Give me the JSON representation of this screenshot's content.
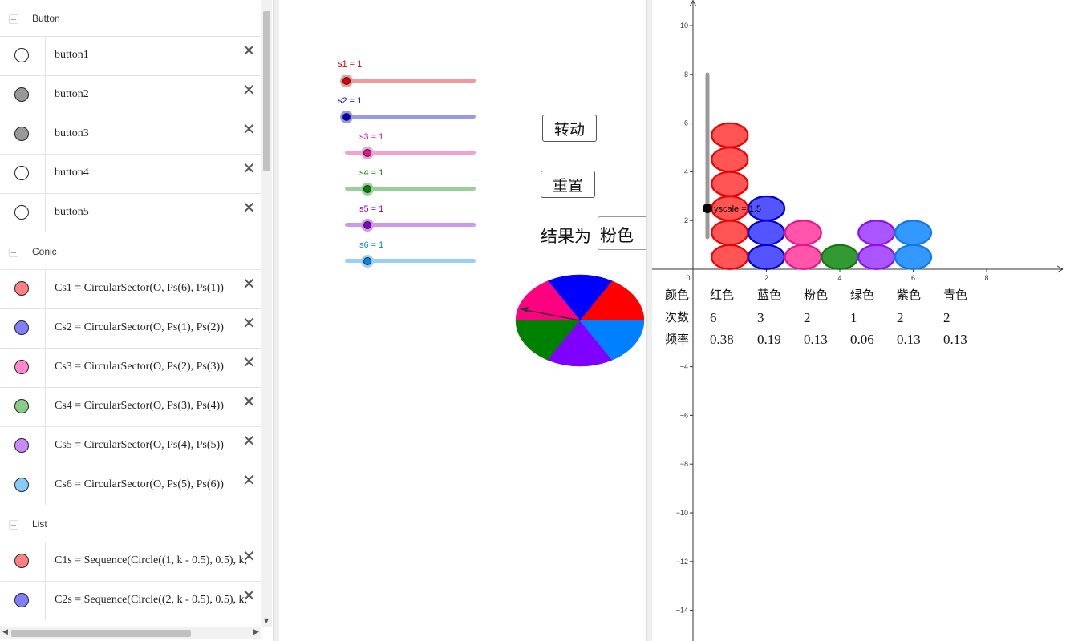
{
  "algebra": {
    "groups": [
      {
        "name": "Button",
        "items": [
          {
            "label": "button1",
            "color": "#ffffff"
          },
          {
            "label": "button2",
            "color": "#999999"
          },
          {
            "label": "button3",
            "color": "#999999"
          },
          {
            "label": "button4",
            "color": "#ffffff"
          },
          {
            "label": "button5",
            "color": "#ffffff"
          }
        ]
      },
      {
        "name": "Conic",
        "items": [
          {
            "label": "Cs1 = CircularSector(O, Ps(6), Ps(1))",
            "color": "#ff8080"
          },
          {
            "label": "Cs2 = CircularSector(O, Ps(1), Ps(2))",
            "color": "#8080ff"
          },
          {
            "label": "Cs3 = CircularSector(O, Ps(2), Ps(3))",
            "color": "#ff88c8"
          },
          {
            "label": "Cs4 = CircularSector(O, Ps(3), Ps(4))",
            "color": "#88cc88"
          },
          {
            "label": "Cs5 = CircularSector(O, Ps(4), Ps(5))",
            "color": "#cc88ff"
          },
          {
            "label": "Cs6 = CircularSector(O, Ps(5), Ps(6))",
            "color": "#88ccff"
          }
        ]
      },
      {
        "name": "List",
        "items": [
          {
            "label": "C1s = Sequence(Circle((1, k - 0.5), 0.5), k,",
            "color": "#ff8080"
          },
          {
            "label": "C2s = Sequence(Circle((2, k - 0.5), 0.5), k,",
            "color": "#8080ff"
          }
        ]
      }
    ],
    "delete_glyph": "✕"
  },
  "sliders": [
    {
      "label": "s1 = 1",
      "color": "#dd0000",
      "value": 1
    },
    {
      "label": "s2 = 1",
      "color": "#0000cc",
      "value": 1
    },
    {
      "label": "s3 = 1",
      "color": "#e0168b",
      "value": 1
    },
    {
      "label": "s4 = 1",
      "color": "#008800",
      "value": 1
    },
    {
      "label": "s5 = 1",
      "color": "#8800cc",
      "value": 1
    },
    {
      "label": "s6 = 1",
      "color": "#0088ee",
      "value": 1
    }
  ],
  "buttons": {
    "spin": "转动",
    "reset": "重置"
  },
  "result": {
    "label": "结果为",
    "value": "粉色"
  },
  "spinner": {
    "sectors": [
      {
        "name": "红色",
        "color": "#ff0000"
      },
      {
        "name": "蓝色",
        "color": "#0000ff"
      },
      {
        "name": "粉色",
        "color": "#ff0080"
      },
      {
        "name": "绿色",
        "color": "#008000"
      },
      {
        "name": "紫色",
        "color": "#8000ff"
      },
      {
        "name": "青色",
        "color": "#0080ff"
      }
    ]
  },
  "chart_data": {
    "type": "scatter",
    "x_ticks": [
      "0",
      "2",
      "4",
      "6",
      "8"
    ],
    "y_ticks": [
      "10",
      "8",
      "6",
      "4",
      "2",
      "−4",
      "−6",
      "−8",
      "−10",
      "−12",
      "−14"
    ],
    "xlim": [
      -1,
      10.2
    ],
    "ylim": [
      -15.3,
      11
    ],
    "yscale_label": "yscale = 1.5",
    "yscale_value": 1.5,
    "columns": [
      {
        "x": 1,
        "count": 6,
        "fill": "#ff5555",
        "stroke": "#ee0000"
      },
      {
        "x": 2,
        "count": 3,
        "fill": "#5555ff",
        "stroke": "#0000cc"
      },
      {
        "x": 3,
        "count": 2,
        "fill": "#ff55aa",
        "stroke": "#ee1188"
      },
      {
        "x": 4,
        "count": 1,
        "fill": "#339933",
        "stroke": "#117711"
      },
      {
        "x": 5,
        "count": 2,
        "fill": "#aa55ff",
        "stroke": "#8811ee"
      },
      {
        "x": 6,
        "count": 2,
        "fill": "#3399ff",
        "stroke": "#1177ee"
      }
    ],
    "table": {
      "header": [
        "颜色",
        "红色",
        "蓝色",
        "粉色",
        "绿色",
        "紫色",
        "青色"
      ],
      "count_label": "次数",
      "counts": [
        "6",
        "3",
        "2",
        "1",
        "2",
        "2"
      ],
      "freq_label": "频率",
      "freqs": [
        "0.38",
        "0.19",
        "0.13",
        "0.06",
        "0.13",
        "0.13"
      ]
    }
  }
}
